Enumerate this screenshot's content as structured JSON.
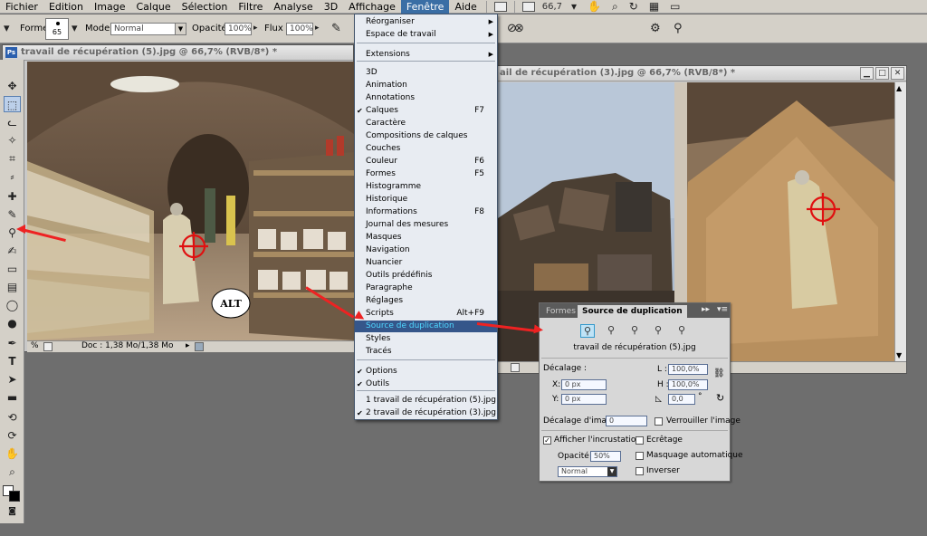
{
  "menubar": {
    "items": [
      "Fichier",
      "Edition",
      "Image",
      "Calque",
      "Sélection",
      "Filtre",
      "Analyse",
      "3D",
      "Affichage",
      "Fenêtre",
      "Aide"
    ],
    "active_index": 9,
    "zoom": "66,7"
  },
  "options": {
    "forme_label": "Forme :",
    "brush_size": "65",
    "mode_label": "Mode:",
    "mode_value": "Normal",
    "opacite_label": "Opacité :",
    "opacite_value": "100%",
    "flux_label": "Flux :",
    "flux_value": "100%"
  },
  "doc_left": {
    "title": "travail de récupération (5).jpg @ 66,7% (RVB/8*) *",
    "zoom_status": "%",
    "doc_size": "Doc : 1,38 Mo/1,38 Mo",
    "alt_label": "ALT"
  },
  "doc_right": {
    "title": "ail de récupération (3).jpg @ 66,7% (RVB/8*) *"
  },
  "fenetre_menu": {
    "items": [
      {
        "label": "Réorganiser",
        "sub": true
      },
      {
        "label": "Espace de travail",
        "sub": true
      },
      {
        "label": "Extensions",
        "sub": true
      },
      {
        "label": "3D"
      },
      {
        "label": "Animation"
      },
      {
        "label": "Annotations"
      },
      {
        "label": "Calques",
        "shortcut": "F7",
        "checked": true
      },
      {
        "label": "Caractère"
      },
      {
        "label": "Compositions de calques"
      },
      {
        "label": "Couches"
      },
      {
        "label": "Couleur",
        "shortcut": "F6"
      },
      {
        "label": "Formes",
        "shortcut": "F5"
      },
      {
        "label": "Histogramme"
      },
      {
        "label": "Historique"
      },
      {
        "label": "Informations",
        "shortcut": "F8"
      },
      {
        "label": "Journal des mesures"
      },
      {
        "label": "Masques"
      },
      {
        "label": "Navigation"
      },
      {
        "label": "Nuancier"
      },
      {
        "label": "Outils prédéfinis"
      },
      {
        "label": "Paragraphe"
      },
      {
        "label": "Réglages"
      },
      {
        "label": "Scripts",
        "shortcut": "Alt+F9"
      },
      {
        "label": "Source de duplication",
        "highlighted": true
      },
      {
        "label": "Styles"
      },
      {
        "label": "Tracés"
      },
      {
        "label": "Options",
        "checked": true
      },
      {
        "label": "Outils",
        "checked": true
      },
      {
        "label": "1 travail de récupération (5).jpg"
      },
      {
        "label": "2 travail de récupération (3).jpg",
        "checked": true
      }
    ]
  },
  "panel": {
    "tab_formes": "Formes",
    "tab_source": "Source de duplication",
    "source_file": "travail de récupération (5).jpg",
    "decalage_label": "Décalage :",
    "x_label": "X:",
    "x_value": "0 px",
    "y_label": "Y:",
    "y_value": "0 px",
    "w_label": "L :",
    "w_value": "100,0%",
    "h_label": "H :",
    "h_value": "100,0%",
    "angle_value": "0,0",
    "degree": "°",
    "frame_offset_label": "Décalage d'image :",
    "frame_offset_value": "0",
    "lock_frame_label": "Verrouiller l'image",
    "show_overlay_label": "Afficher l'incrustation",
    "opacity_label": "Opacité :",
    "opacity_value": "50%",
    "blend_value": "Normal",
    "clipped_label": "Ecrêtage",
    "auto_hide_label": "Masquage automatique",
    "invert_label": "Inverser"
  },
  "colors": {
    "accent": "#35568a",
    "highlight_text": "#4fd7ff",
    "arrow": "#e22222"
  }
}
